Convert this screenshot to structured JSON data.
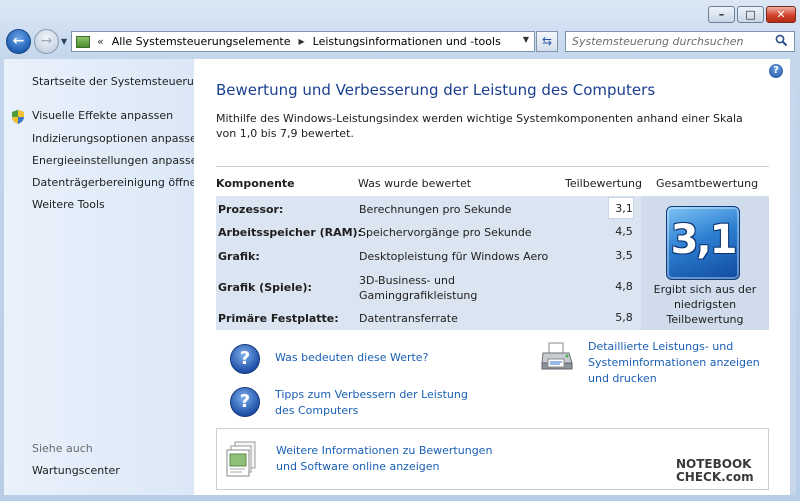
{
  "window": {
    "caption_buttons": [
      "minimize",
      "maximize",
      "close"
    ]
  },
  "nav": {
    "address_crumbs": [
      "Alle Systemsteuerungselemente",
      "Leistungsinformationen und -tools"
    ],
    "search_placeholder": "Systemsteuerung durchsuchen"
  },
  "sidebar": {
    "home_link": "Startseite der Systemsteuerung",
    "tasks": [
      "Visuelle Effekte anpassen",
      "Indizierungsoptionen anpassen",
      "Energieeinstellungen anpassen",
      "Datenträgerbereinigung öffnen",
      "Weitere Tools"
    ],
    "see_also_heading": "Siehe auch",
    "see_also_links": [
      "Wartungscenter"
    ]
  },
  "main": {
    "title": "Bewertung und Verbesserung der Leistung des Computers",
    "intro": "Mithilfe des Windows-Leistungsindex werden wichtige Systemkomponenten anhand einer Skala von 1,0 bis 7,9 bewertet.",
    "table": {
      "headers": [
        "Komponente",
        "Was wurde bewertet",
        "Teilbewertung",
        "Gesamtbewertung"
      ],
      "rows": [
        {
          "component": "Prozessor:",
          "rated": "Berechnungen pro Sekunde",
          "score": "3,1"
        },
        {
          "component": "Arbeitsspeicher (RAM):",
          "rated": "Speichervorgänge pro Sekunde",
          "score": "4,5"
        },
        {
          "component": "Grafik:",
          "rated": "Desktopleistung für Windows Aero",
          "score": "3,5"
        },
        {
          "component": "Grafik (Spiele):",
          "rated": "3D-Business- und Gaminggrafikleistung",
          "score": "4,8"
        },
        {
          "component": "Primäre Festplatte:",
          "rated": "Datentransferrate",
          "score": "5,8"
        }
      ],
      "base_score": "3,1",
      "base_score_note": "Ergibt sich aus der niedrigsten Teilbewertung"
    },
    "links": {
      "what_mean": "Was bedeuten diese Werte?",
      "tips": "Tipps zum Verbessern der Leistung des Computers",
      "details": "Detaillierte Leistungs- und Systeminformationen anzeigen und drucken",
      "online": "Weitere Informationen zu Bewertungen und Software online anzeigen"
    },
    "watermark": {
      "line1": "NOTEBOOK",
      "line2": "CHECK.com"
    }
  },
  "colors": {
    "title_blue": "#1b3f8f",
    "link_blue": "#1a5fb4",
    "table_bg": "#dbe4f1"
  }
}
